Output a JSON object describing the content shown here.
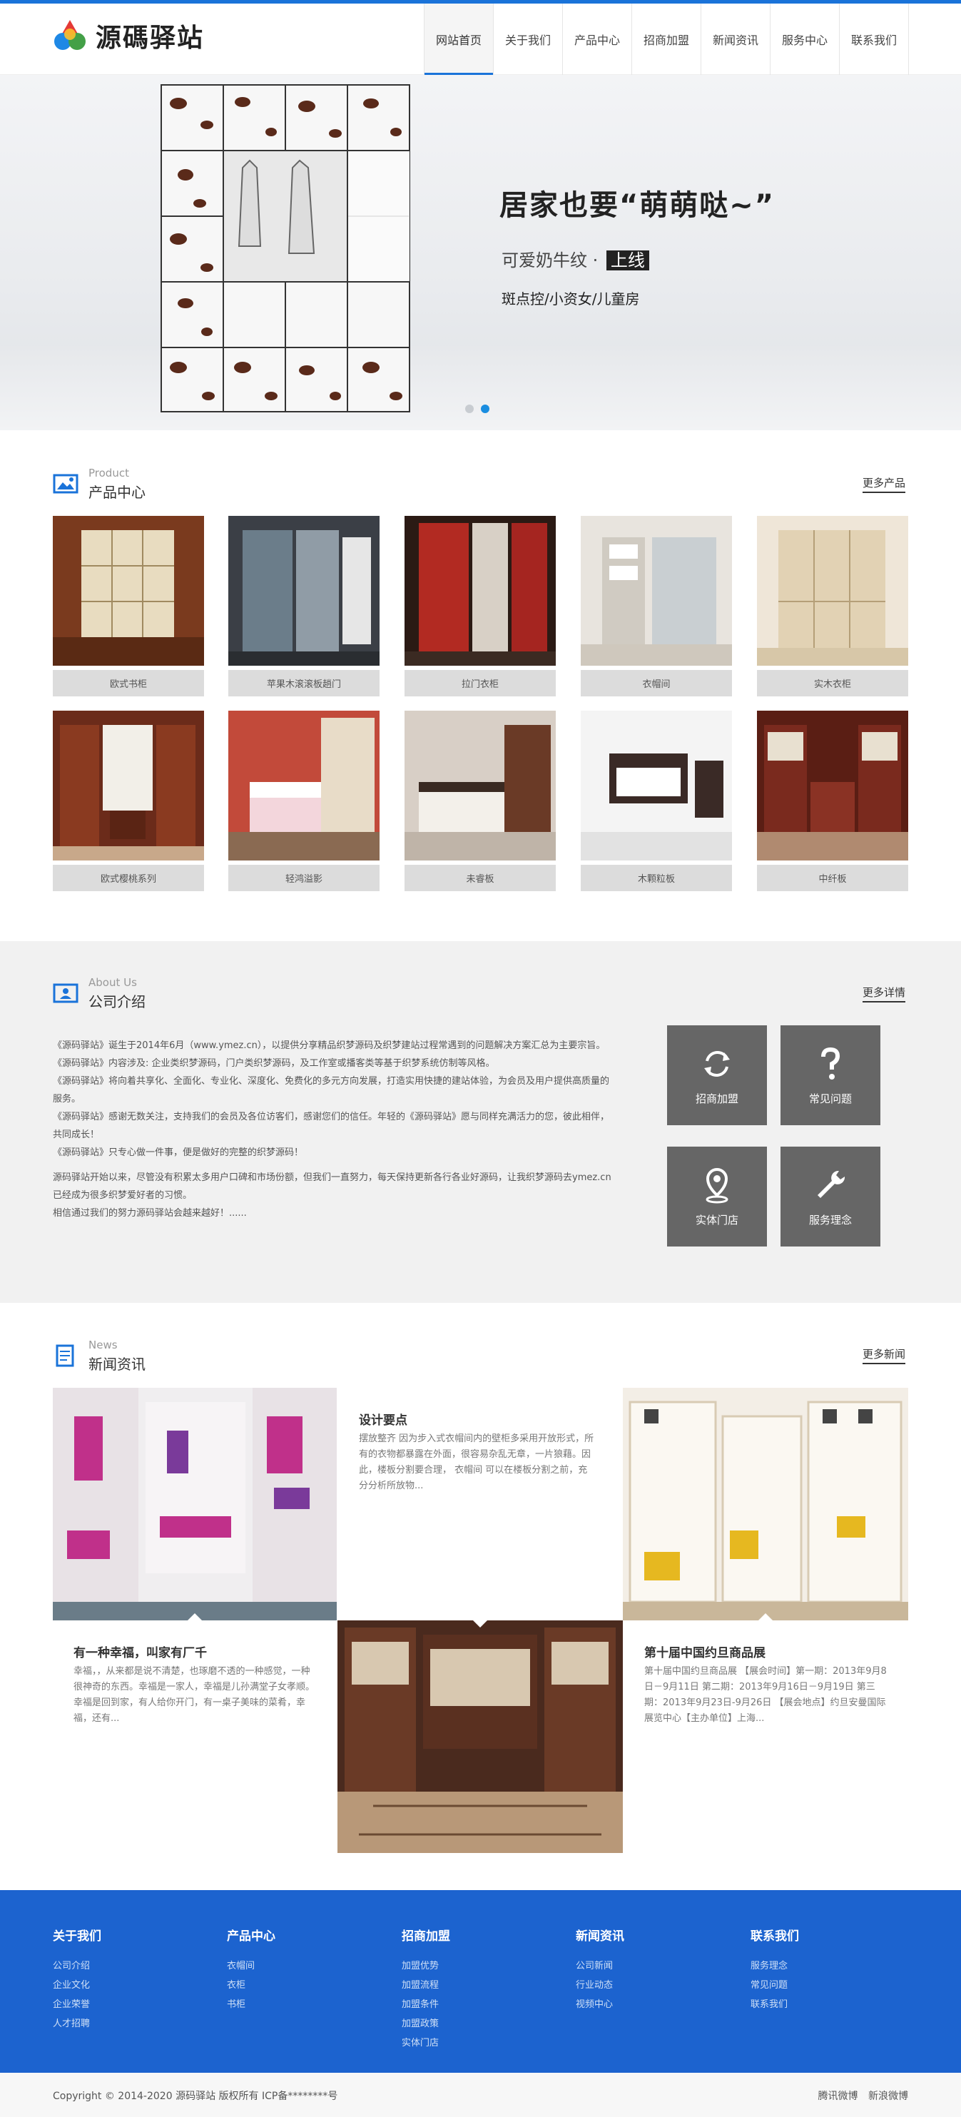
{
  "header": {
    "logo_text": "源碼驿站",
    "nav": [
      "网站首页",
      "关于我们",
      "产品中心",
      "招商加盟",
      "新闻资讯",
      "服务中心",
      "联系我们"
    ]
  },
  "banner": {
    "title": "居家也要“萌萌哒~”",
    "subtitle": "可爱奶牛纹 · ",
    "subtitle_tag": "上线",
    "line3": "斑点控/小资女/儿童房"
  },
  "products": {
    "en": "Product",
    "cn": "产品中心",
    "more": "更多产品",
    "items": [
      {
        "label": "欧式书柜"
      },
      {
        "label": "苹果木滚滚板趟门"
      },
      {
        "label": "拉门衣柜"
      },
      {
        "label": "衣帽间"
      },
      {
        "label": "实木衣柜"
      },
      {
        "label": "欧式樱桃系列"
      },
      {
        "label": "轻鸿溢影"
      },
      {
        "label": "未睿板"
      },
      {
        "label": "木颗粒板"
      },
      {
        "label": "中纤板"
      }
    ]
  },
  "about": {
    "en": "About Us",
    "cn": "公司介绍",
    "more": "更多详情",
    "paragraphs": [
      "《源码驿站》诞生于2014年6月（www.ymez.cn），以提供分享精品织梦源码及织梦建站过程常遇到的问题解决方案汇总为主要宗旨。",
      "《源码驿站》内容涉及: 企业类织梦源码，门户类织梦源码，及工作室或播客类等基于织梦系统仿制等风格。",
      "《源码驿站》将向着共享化、全面化、专业化、深度化、免费化的多元方向发展，打造实用快捷的建站体验，为会员及用户提供高质量的服务。",
      "《源码驿站》感谢无数关注，支持我们的会员及各位访客们，感谢您们的信任。年轻的《源码驿站》愿与同样充满活力的您，彼此相伴，共同成长！",
      "《源码驿站》只专心做一件事，便是做好的完整的织梦源码！"
    ],
    "paragraphs2": [
      "源码驿站开始以来，尽管没有积累太多用户口碑和市场份额，但我们一直努力，每天保持更新各行各业好源码，让我织梦源码去ymez.cn已经成为很多织梦爱好者的习惯。",
      "相信通过我们的努力源码驿站会越来越好！......"
    ],
    "tiles": [
      "招商加盟",
      "常见问题",
      "实体门店",
      "服务理念"
    ]
  },
  "news": {
    "en": "News",
    "cn": "新闻资讯",
    "more": "更多新闻",
    "items": [
      {
        "title": "设计要点",
        "body": "摆放整齐 因为步入式衣帽间内的壁柜多采用开放形式，所有的衣物都暴露在外面，很容易杂乱无章，一片狼藉。因此，楼板分割要合理， 衣帽间 可以在楼板分割之前，充分分析所放物..."
      },
      {
        "title": "有一种幸福，叫家有厂千",
        "body": "幸福，，从来都是说不清楚，也琢磨不透的一种感觉，一种很神奇的东西。幸福是一家人，幸福是儿孙满堂子女孝顺。幸福是回到家，有人给你开门，有一桌子美味的菜肴，幸福，还有..."
      },
      {
        "title": "第十届中国约旦商品展",
        "body": "第十届中国约旦商品展 【展会时间】第一期：2013年9月8日－9月11日 第二期：2013年9月16日－9月19日 第三期：2013年9月23日-9月26日 【展会地点】约旦安曼国际展览中心【主办单位】上海..."
      }
    ]
  },
  "footer": {
    "cols": [
      {
        "title": "关于我们",
        "links": [
          "公司介绍",
          "企业文化",
          "企业荣誉",
          "人才招聘"
        ]
      },
      {
        "title": "产品中心",
        "links": [
          "衣帽间",
          "衣柜",
          "书柜"
        ]
      },
      {
        "title": "招商加盟",
        "links": [
          "加盟优势",
          "加盟流程",
          "加盟条件",
          "加盟政策",
          "实体门店"
        ]
      },
      {
        "title": "新闻资讯",
        "links": [
          "公司新闻",
          "行业动态",
          "视频中心"
        ]
      },
      {
        "title": "联系我们",
        "links": [
          "服务理念",
          "常见问题",
          "联系我们"
        ]
      }
    ],
    "copyright": "Copyright © 2014-2020 源码驿站 版权所有   ICP备********号",
    "social": [
      "腾讯微博",
      "新浪微博"
    ]
  },
  "colors": {
    "brand": "#1a73d9",
    "footer": "#1c63cf",
    "tile": "#666666"
  }
}
